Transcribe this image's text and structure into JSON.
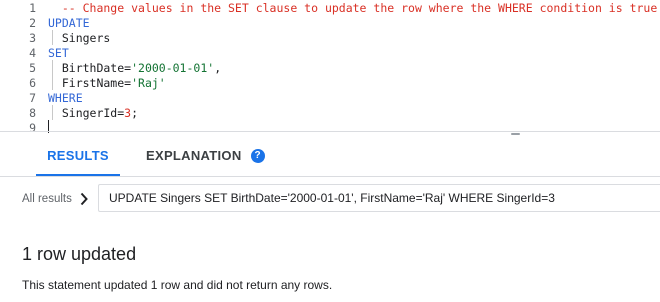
{
  "editor": {
    "lines": [
      {
        "num": "1",
        "parts": [
          {
            "t": "  -- Change values in the SET clause to update the row where the WHERE condition is true.",
            "k": "c"
          }
        ]
      },
      {
        "num": "2",
        "parts": [
          {
            "t": "UPDATE",
            "k": "k"
          }
        ]
      },
      {
        "num": "3",
        "parts": [
          {
            "t": "  Singers",
            "k": "p"
          }
        ]
      },
      {
        "num": "4",
        "parts": [
          {
            "t": "SET",
            "k": "k"
          }
        ]
      },
      {
        "num": "5",
        "parts": [
          {
            "t": "  BirthDate=",
            "k": "p"
          },
          {
            "t": "'2000-01-01'",
            "k": "s"
          },
          {
            "t": ",",
            "k": "p"
          }
        ]
      },
      {
        "num": "6",
        "parts": [
          {
            "t": "  FirstName=",
            "k": "p"
          },
          {
            "t": "'Raj'",
            "k": "s"
          }
        ]
      },
      {
        "num": "7",
        "parts": [
          {
            "t": "WHERE",
            "k": "k"
          }
        ]
      },
      {
        "num": "8",
        "parts": [
          {
            "t": "  SingerId=",
            "k": "p"
          },
          {
            "t": "3",
            "k": "n"
          },
          {
            "t": ";",
            "k": "p"
          }
        ]
      },
      {
        "num": "9",
        "parts": []
      }
    ]
  },
  "tabs": {
    "results": "RESULTS",
    "explanation": "EXPLANATION",
    "help_icon": "?"
  },
  "breadcrumb": {
    "all_results": "All results",
    "query": "UPDATE Singers SET BirthDate='2000-01-01', FirstName='Raj' WHERE SingerId=3"
  },
  "result": {
    "title": "1 row updated",
    "description": "This statement updated 1 row and did not return any rows."
  },
  "colors": {
    "accent": "#1a73e8",
    "keyword": "#3367d6",
    "comment": "#d93025",
    "string": "#137333",
    "number": "#d93025"
  }
}
